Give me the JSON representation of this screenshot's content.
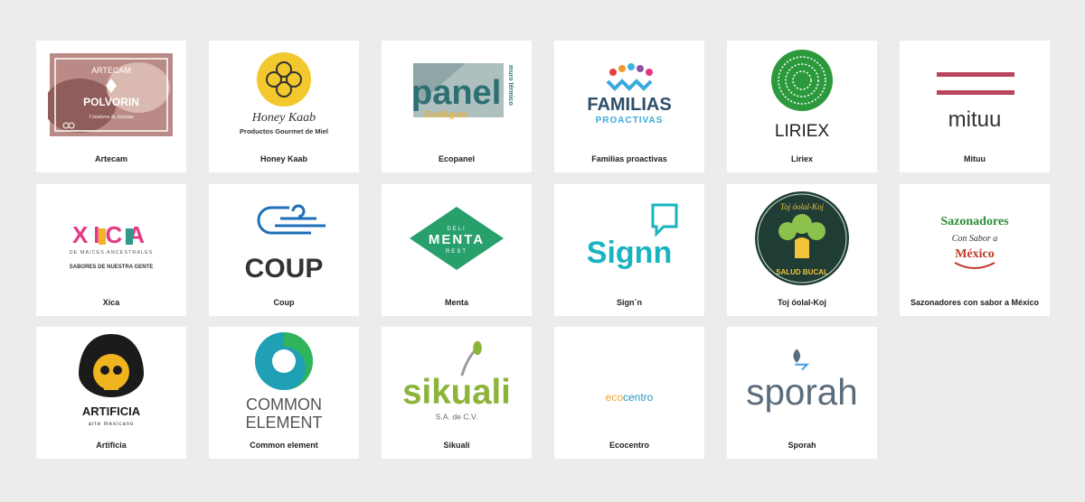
{
  "colors": {
    "page_background": "#ececec",
    "card_background": "#ffffff",
    "caption_text": "#222222"
  },
  "cards": [
    {
      "caption": "Artecam",
      "logo": {
        "line1": "ARTECAM",
        "line2": "POLVORIN",
        "line3": "Creativos & Artistas"
      }
    },
    {
      "caption": "Honey Kaab",
      "logo": {
        "name": "Honey Kaab",
        "tagline": "Productos Gourmet de Miel"
      }
    },
    {
      "caption": "Ecopanel",
      "logo": {
        "word": "panel",
        "eco": "Ecológico",
        "side": "muro térmico"
      }
    },
    {
      "caption": "Familias proactivas",
      "logo": {
        "line1": "FAMILIAS",
        "line2": "PROACTIVAS"
      }
    },
    {
      "caption": "Liriex",
      "logo": {
        "word": "LIRIEX"
      }
    },
    {
      "caption": "Mituu",
      "logo": {
        "word": "mituu"
      }
    },
    {
      "caption": "Xica",
      "logo": {
        "word": "XICA",
        "line2": "DE MAICES ANCESTRALES",
        "line3": "SABORES DE NUESTRA GENTE"
      }
    },
    {
      "caption": "Coup",
      "logo": {
        "word": "COUP"
      }
    },
    {
      "caption": "Menta",
      "logo": {
        "top": "DELI",
        "word": "MENTA",
        "bottom": "REST"
      }
    },
    {
      "caption": "Sign´n",
      "logo": {
        "word": "Signn"
      }
    },
    {
      "caption": "Toj óolal-Koj",
      "logo": {
        "top": "Toj óolal-Koj",
        "bottom": "SALUD BUCAL"
      }
    },
    {
      "caption": "Sazonadores con sabor a México",
      "logo": {
        "line1": "Sazonadores",
        "line2": "Con Sabor a",
        "line3": "México"
      }
    },
    {
      "caption": "Artificia",
      "logo": {
        "word": "ARTIFICIA",
        "tagline": "arte mexicano"
      }
    },
    {
      "caption": "Common element",
      "logo": {
        "line1": "COMMON",
        "line2": "ELEMENT"
      }
    },
    {
      "caption": "Sikuali",
      "logo": {
        "word": "sikuali",
        "tagline": "S.A. de C.V."
      }
    },
    {
      "caption": "Ecocentro",
      "logo": {
        "part1": "eco",
        "part2": "centro"
      }
    },
    {
      "caption": "Sporah",
      "logo": {
        "word": "sporah"
      }
    }
  ]
}
